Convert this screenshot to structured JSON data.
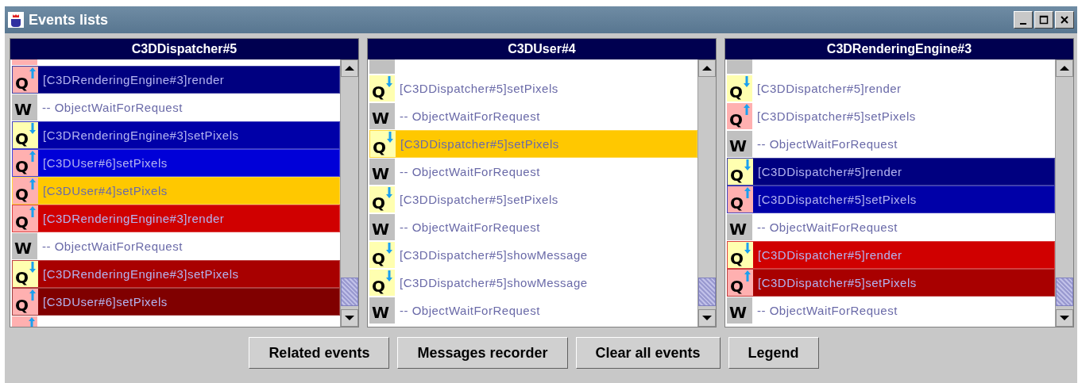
{
  "window": {
    "title": "Events lists"
  },
  "panels": [
    {
      "title": "C3DDispatcher#5",
      "rows": [
        {
          "kind": "sent"
        },
        {
          "kind": "sent",
          "badge": "Q",
          "text": "[C3DRenderingEngine#3]render",
          "color": "#000080"
        },
        {
          "kind": "wait",
          "badge": "W",
          "text": "-- ObjectWaitForRequest"
        },
        {
          "kind": "received",
          "badge": "Q",
          "text": "[C3DRenderingEngine#3]setPixels",
          "color": "#0000a8"
        },
        {
          "kind": "sent",
          "badge": "Q",
          "text": "[C3DUser#6]setPixels",
          "color": "#0000d8"
        },
        {
          "kind": "sent",
          "badge": "Q",
          "text": "[C3DUser#4]setPixels",
          "color": "#ffc800"
        },
        {
          "kind": "sent",
          "badge": "Q",
          "text": "[C3DRenderingEngine#3]render",
          "color": "#d00000"
        },
        {
          "kind": "wait",
          "badge": "W",
          "text": "-- ObjectWaitForRequest"
        },
        {
          "kind": "received",
          "badge": "Q",
          "text": "[C3DRenderingEngine#3]setPixels",
          "color": "#a80000"
        },
        {
          "kind": "sent",
          "badge": "Q",
          "text": "[C3DUser#6]setPixels",
          "color": "#800000"
        },
        {
          "kind": "sent"
        }
      ]
    },
    {
      "title": "C3DUser#4",
      "rows": [
        {
          "kind": "wait"
        },
        {
          "kind": "received",
          "badge": "Q",
          "text": "[C3DDispatcher#5]setPixels"
        },
        {
          "kind": "wait",
          "badge": "W",
          "text": "-- ObjectWaitForRequest"
        },
        {
          "kind": "received",
          "badge": "Q",
          "text": "[C3DDispatcher#5]setPixels",
          "color": "#ffc800"
        },
        {
          "kind": "wait",
          "badge": "W",
          "text": "-- ObjectWaitForRequest"
        },
        {
          "kind": "received",
          "badge": "Q",
          "text": "[C3DDispatcher#5]setPixels"
        },
        {
          "kind": "wait",
          "badge": "W",
          "text": "-- ObjectWaitForRequest"
        },
        {
          "kind": "received",
          "badge": "Q",
          "text": "[C3DDispatcher#5]showMessage"
        },
        {
          "kind": "received",
          "badge": "Q",
          "text": "[C3DDispatcher#5]showMessage"
        },
        {
          "kind": "wait",
          "badge": "W",
          "text": "-- ObjectWaitForRequest"
        }
      ]
    },
    {
      "title": "C3DRenderingEngine#3",
      "rows": [
        {
          "kind": "wait"
        },
        {
          "kind": "received",
          "badge": "Q",
          "text": "[C3DDispatcher#5]render"
        },
        {
          "kind": "sent",
          "badge": "Q",
          "text": "[C3DDispatcher#5]setPixels"
        },
        {
          "kind": "wait",
          "badge": "W",
          "text": "-- ObjectWaitForRequest"
        },
        {
          "kind": "received",
          "badge": "Q",
          "text": "[C3DDispatcher#5]render",
          "color": "#000080"
        },
        {
          "kind": "sent",
          "badge": "Q",
          "text": "[C3DDispatcher#5]setPixels",
          "color": "#0000a8"
        },
        {
          "kind": "wait",
          "badge": "W",
          "text": "-- ObjectWaitForRequest"
        },
        {
          "kind": "received",
          "badge": "Q",
          "text": "[C3DDispatcher#5]render",
          "color": "#d00000"
        },
        {
          "kind": "sent",
          "badge": "Q",
          "text": "[C3DDispatcher#5]setPixels",
          "color": "#a80000"
        },
        {
          "kind": "wait",
          "badge": "W",
          "text": "-- ObjectWaitForRequest"
        }
      ]
    }
  ],
  "buttons": [
    "Related events",
    "Messages recorder",
    "Clear all events",
    "Legend"
  ]
}
